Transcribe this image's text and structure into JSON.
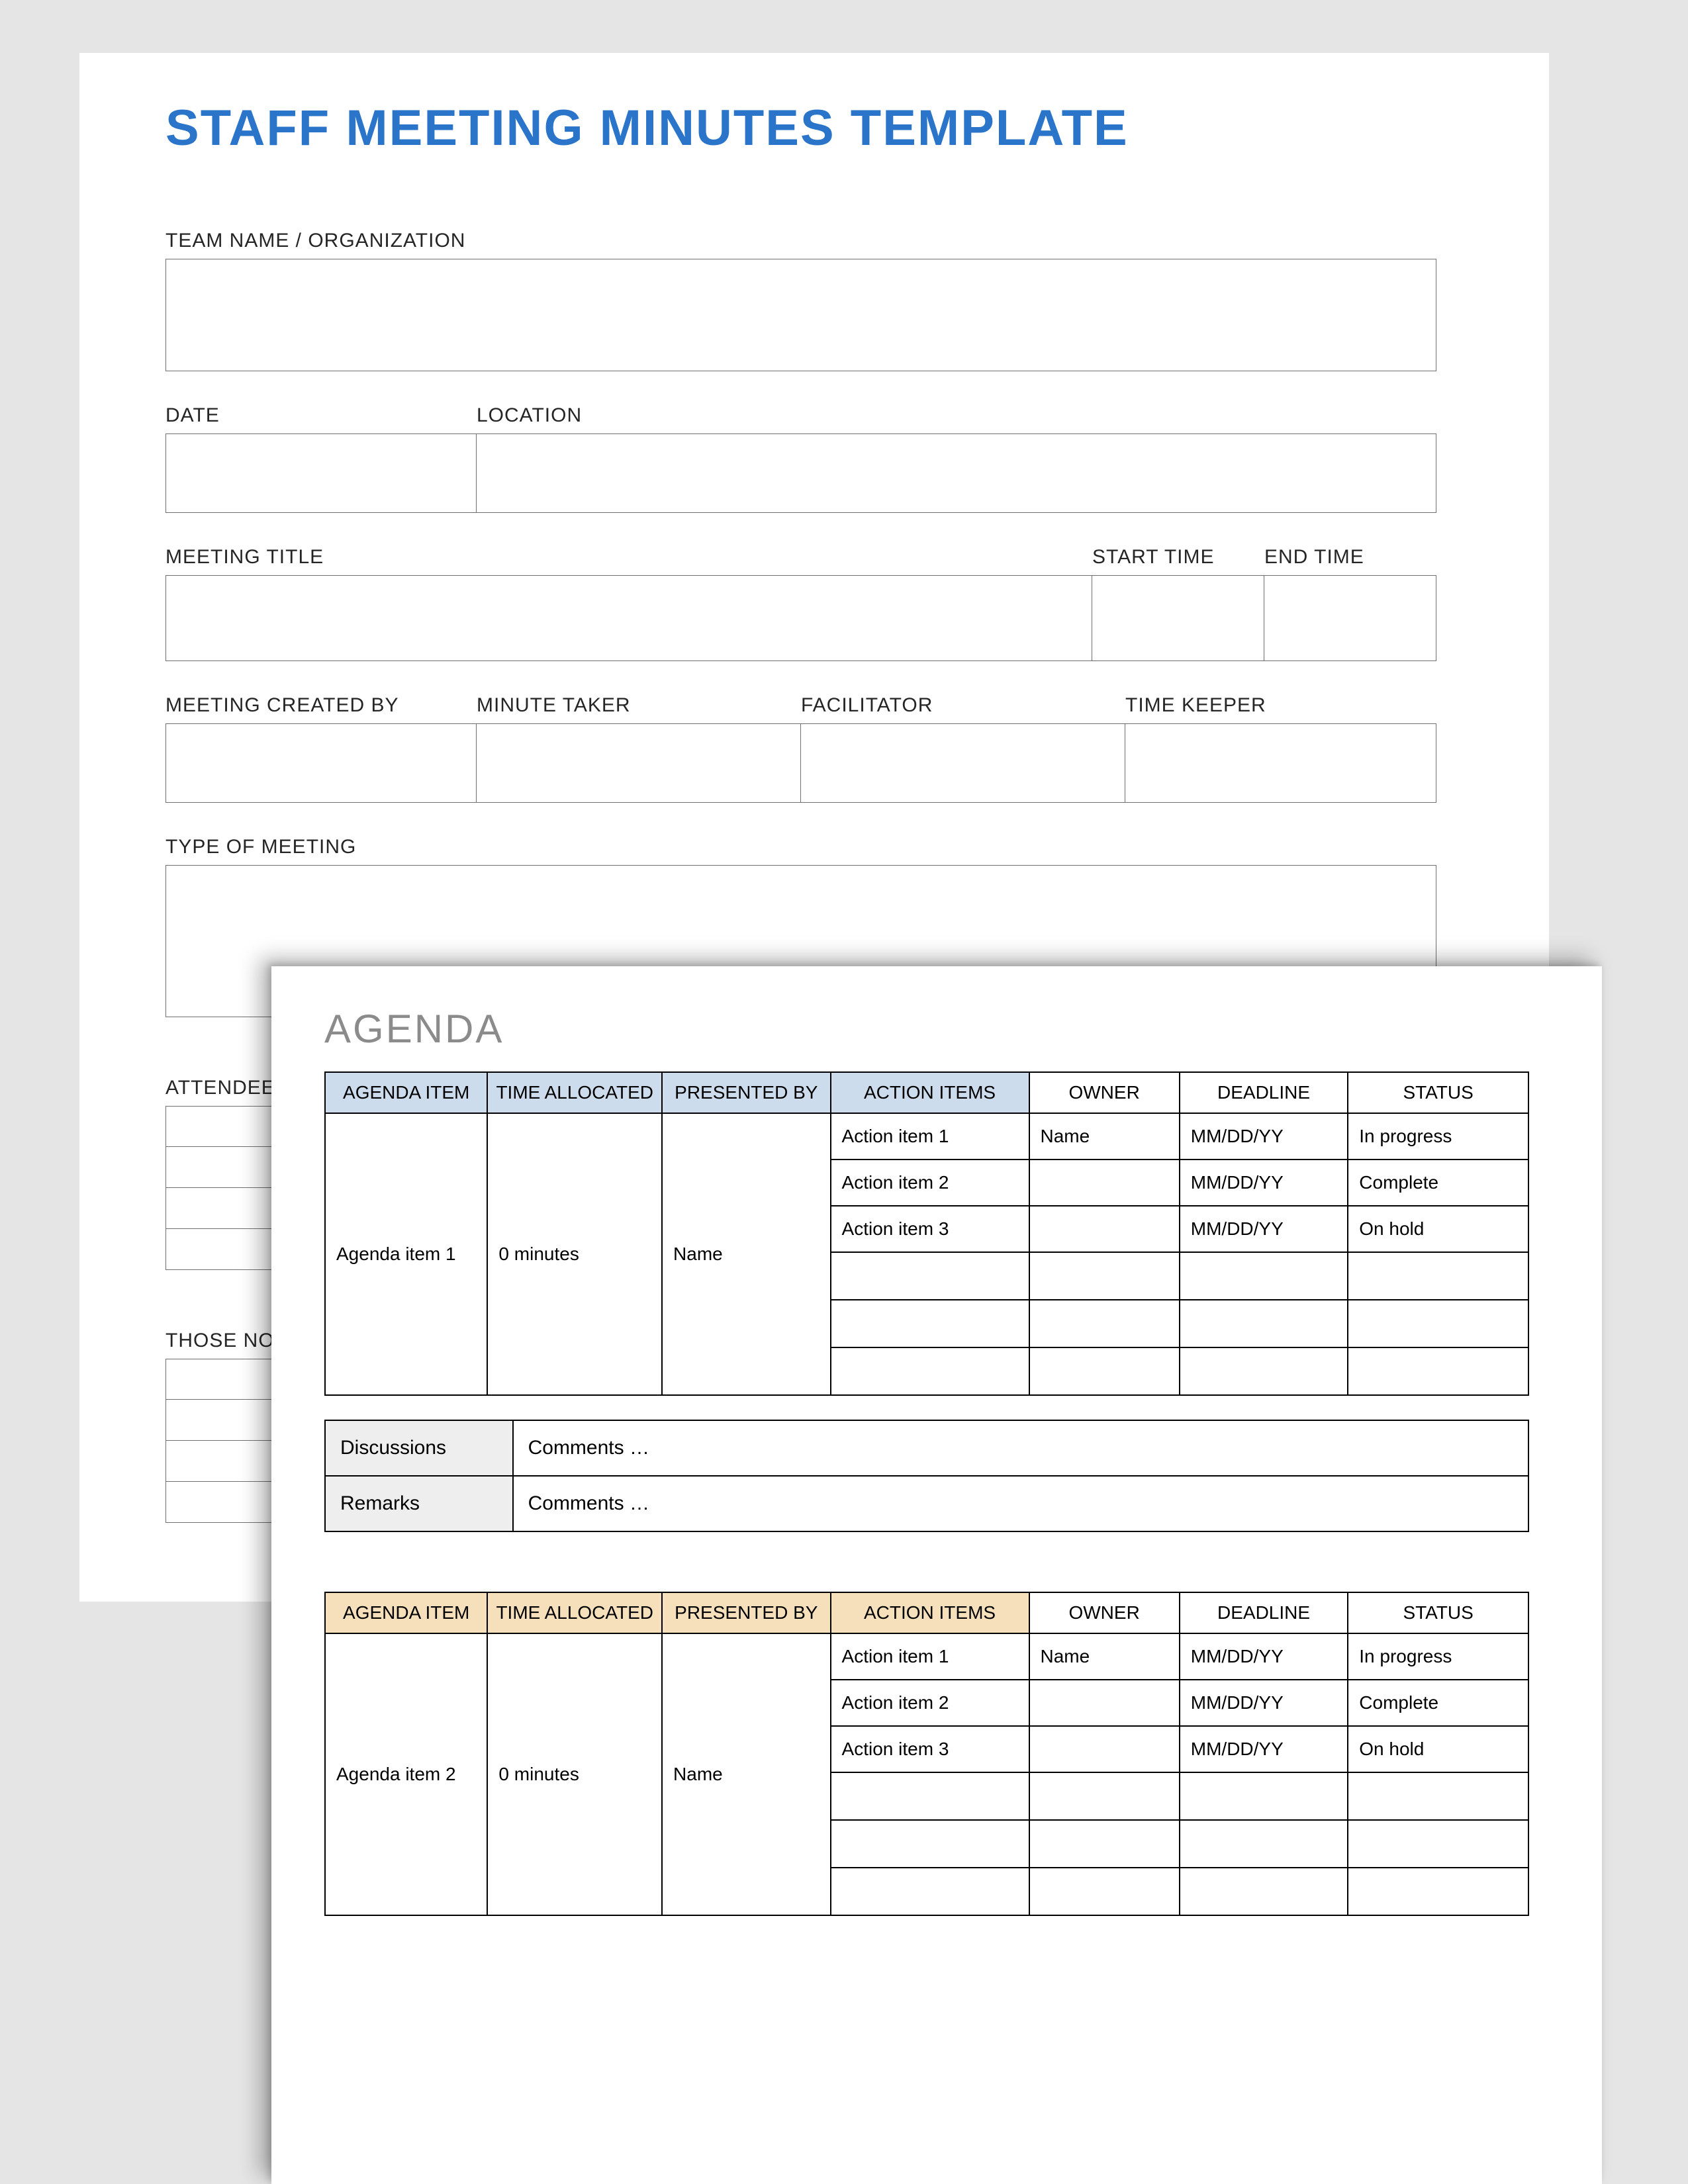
{
  "title": "STAFF MEETING MINUTES TEMPLATE",
  "labels": {
    "team": "TEAM NAME / ORGANIZATION",
    "date": "DATE",
    "location": "LOCATION",
    "meeting_title": "MEETING TITLE",
    "start_time": "START TIME",
    "end_time": "END TIME",
    "created_by": "MEETING CREATED BY",
    "minute_taker": "MINUTE TAKER",
    "facilitator": "FACILITATOR",
    "time_keeper": "TIME KEEPER",
    "type": "TYPE OF MEETING",
    "attendee": "ATTENDEE NA",
    "absent": "THOSE NOT P"
  },
  "agenda": {
    "heading": "AGENDA",
    "columns": {
      "item": "AGENDA ITEM",
      "time": "TIME ALLOCATED",
      "presented": "PRESENTED BY",
      "action": "ACTION ITEMS",
      "owner": "OWNER",
      "deadline": "DEADLINE",
      "status": "STATUS"
    },
    "notes": {
      "discussions_label": "Discussions",
      "discussions_value": "Comments …",
      "remarks_label": "Remarks",
      "remarks_value": "Comments …"
    },
    "blocks": [
      {
        "item": "Agenda item 1",
        "time": "0 minutes",
        "presented": "Name",
        "rows": [
          {
            "action": "Action item 1",
            "owner": "Name",
            "deadline": "MM/DD/YY",
            "status": "In progress"
          },
          {
            "action": "Action item 2",
            "owner": "",
            "deadline": "MM/DD/YY",
            "status": "Complete"
          },
          {
            "action": "Action item 3",
            "owner": "",
            "deadline": "MM/DD/YY",
            "status": "On hold"
          },
          {
            "action": "",
            "owner": "",
            "deadline": "",
            "status": ""
          },
          {
            "action": "",
            "owner": "",
            "deadline": "",
            "status": ""
          },
          {
            "action": "",
            "owner": "",
            "deadline": "",
            "status": ""
          }
        ]
      },
      {
        "item": "Agenda item 2",
        "time": "0 minutes",
        "presented": "Name",
        "rows": [
          {
            "action": "Action item 1",
            "owner": "Name",
            "deadline": "MM/DD/YY",
            "status": "In progress"
          },
          {
            "action": "Action item 2",
            "owner": "",
            "deadline": "MM/DD/YY",
            "status": "Complete"
          },
          {
            "action": "Action item 3",
            "owner": "",
            "deadline": "MM/DD/YY",
            "status": "On hold"
          },
          {
            "action": "",
            "owner": "",
            "deadline": "",
            "status": ""
          },
          {
            "action": "",
            "owner": "",
            "deadline": "",
            "status": ""
          },
          {
            "action": "",
            "owner": "",
            "deadline": "",
            "status": ""
          }
        ]
      }
    ]
  }
}
